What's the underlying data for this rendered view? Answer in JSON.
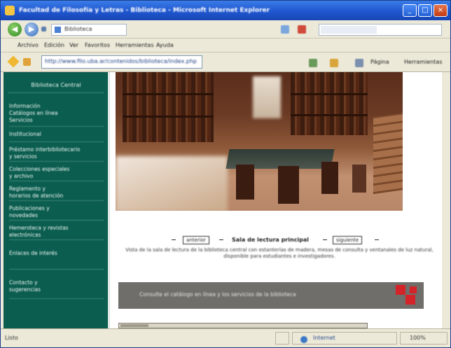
{
  "window": {
    "title": "Facultad de Filosofía y Letras - Biblioteca - Microsoft Internet Explorer",
    "min_glyph": "_",
    "max_glyph": "□",
    "close_glyph": "×"
  },
  "navbar": {
    "back_glyph": "◀",
    "forward_glyph": "▶",
    "tab_label": "Biblioteca"
  },
  "menubar": {
    "items": [
      "Archivo",
      "Edición",
      "Ver",
      "Favoritos",
      "Herramientas",
      "Ayuda"
    ]
  },
  "address": {
    "value": "http://www.filo.uba.ar/contenidos/biblioteca/index.php",
    "toolbar_page": "Página",
    "toolbar_tools": "Herramientas"
  },
  "sidebar": {
    "header": "Biblioteca Central",
    "items": [
      "Información\nCatálogos en línea\nServicios",
      "Institucional",
      "Préstamo interbibliotecario\ny servicios",
      "Colecciones especiales\ny archivo",
      "Reglamento y\nhorarios de atención",
      "Publicaciones y\nnovedades",
      "Hemeroteca y revistas\nelectrónicas",
      "Enlaces de interés",
      "Contacto y\nsugerencias"
    ]
  },
  "caption": {
    "prev_label": "anterior",
    "title": "Sala de lectura principal",
    "next_label": "siguiente",
    "description": "Vista de la sala de lectura de la biblioteca central con estanterías de madera, mesas de consulta y ventanales de luz natural, disponible para estudiantes e investigadores."
  },
  "banner": {
    "text": "Consulte el catálogo en línea y los servicios de la biblioteca"
  },
  "statusbar": {
    "text": "Listo",
    "zone": "Internet",
    "zoom": "100%"
  },
  "colors": {
    "sidebar": "#0b5d4f",
    "titlebar": "#1f56cf",
    "banner": "#6f6e6a",
    "logo_red": "#d4242a"
  }
}
